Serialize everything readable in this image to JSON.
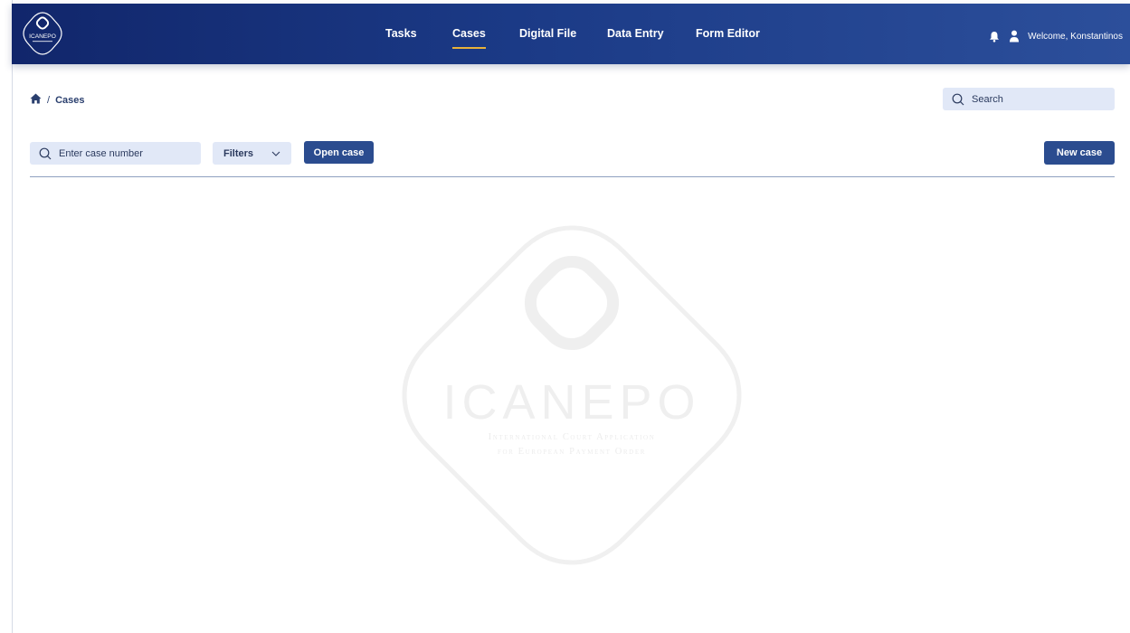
{
  "app": {
    "logo_text": "ICANEPO",
    "nav": [
      {
        "label": "Tasks",
        "active": false
      },
      {
        "label": "Cases",
        "active": true
      },
      {
        "label": "Digital File",
        "active": false
      },
      {
        "label": "Data Entry",
        "active": false
      },
      {
        "label": "Form Editor",
        "active": false
      }
    ],
    "welcome": "Welcome, Konstantinos",
    "icons": {
      "notifications": "bell-icon",
      "user": "user-icon"
    }
  },
  "breadcrumb": {
    "home_icon": "home-icon",
    "separator": "/",
    "current": "Cases"
  },
  "global_search": {
    "placeholder": "Search"
  },
  "toolbar": {
    "case_search_placeholder": "Enter case number",
    "filters_label": "Filters",
    "open_case_label": "Open case",
    "new_case_label": "New case"
  },
  "watermark": {
    "title": "ICANEPO",
    "line1": "International Court Application",
    "line2": "for European Payment Order"
  },
  "colors": {
    "header_start": "#11266b",
    "header_end": "#2c4f9b",
    "accent_underline": "#e8b23a",
    "primary_button": "#2b4c8f",
    "field_bg": "#e1e8f7"
  }
}
